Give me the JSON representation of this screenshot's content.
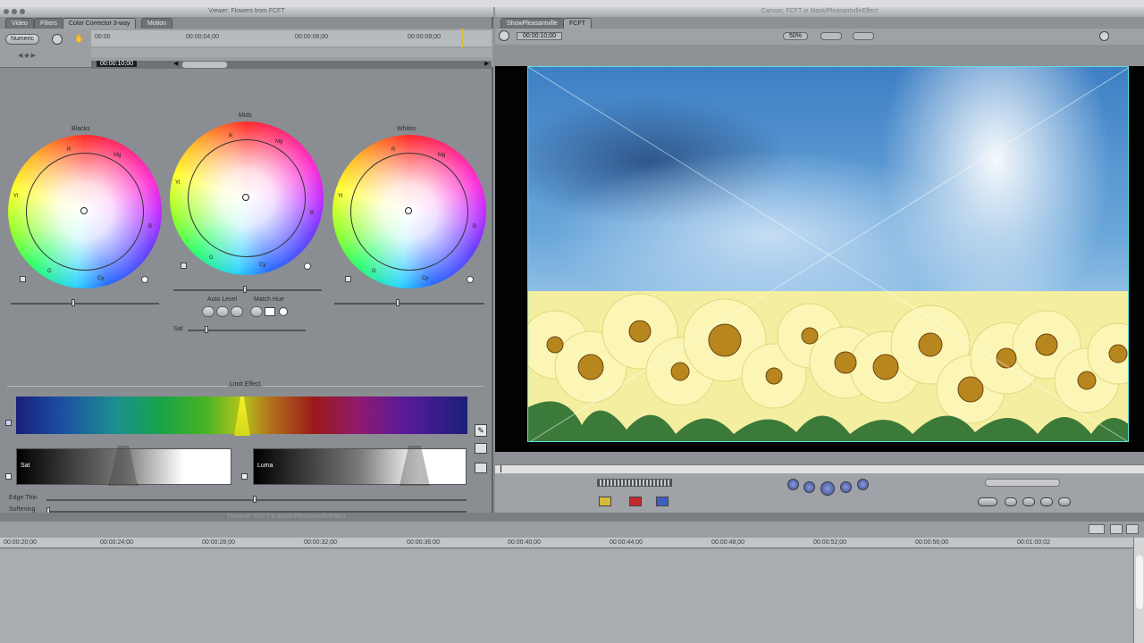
{
  "viewer": {
    "title": "Viewer: Flowers from FCFT",
    "tabs": [
      "Video",
      "Filters",
      "Color Corrector 3-way",
      "Motion"
    ],
    "numeric_button": "Numeric",
    "timecodes": [
      "00:00",
      "00:00:04;00",
      "00:00:08;00",
      "00:00:09;00"
    ],
    "current_tc": "00:00:10;00"
  },
  "wheels": [
    {
      "title": "Blacks"
    },
    {
      "title": "Mids"
    },
    {
      "title": "Whites"
    }
  ],
  "wheel_labels": {
    "r": "R",
    "mg": "Mg",
    "b": "B",
    "cy": "Cy",
    "g": "G",
    "yl": "Yl"
  },
  "auto_level_label": "Auto Level",
  "match_hue_label": "Match Hue",
  "sat_label": "Sat",
  "limit_effect_label": "Limit Effect",
  "sat_box_label": "Sat",
  "luma_box_label": "Luma",
  "edge_thin_label": "Edge Thin",
  "softening_label": "Softening",
  "timeline_title": "Timeline: FCFT in Mask/PleasantvilleEffect",
  "canvas": {
    "title": "Canvas: FCFT in Mask/PleasantvilleEffect",
    "tabs": [
      "ShowPleasantville",
      "FCFT"
    ],
    "current_tc": "00:00:10;00",
    "zoom": "50%"
  },
  "timeline": {
    "ticks": [
      "00:00:20;00",
      "00:00:24;00",
      "00:00:28;00",
      "00:00:32;00",
      "00:00:36;00",
      "00:00:40;00",
      "00:00:44;00",
      "00:00:48;00",
      "00:00:52;00",
      "00:00:56;00",
      "00:01:00;02"
    ]
  }
}
